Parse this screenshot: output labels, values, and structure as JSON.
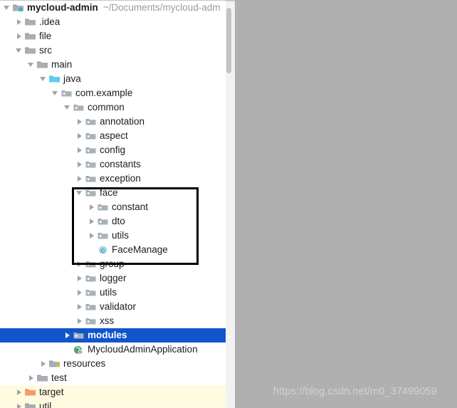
{
  "window": {
    "background_color": "#b0b0b0",
    "panel_background": "#ffffff",
    "selection_color": "#1155cc",
    "tinted_row_color": "#fffbe0",
    "highlight_box_color": "#000000"
  },
  "watermark": {
    "text": "https://blog.csdn.net/m0_37499059"
  },
  "project_tree": {
    "root": {
      "name": "mycloud-admin",
      "path": "~/Documents/mycloud-adm"
    },
    "rows": [
      {
        "label": "mycloud-admin",
        "path": "~/Documents/mycloud-adm",
        "depth": 0,
        "twisty": "expanded",
        "icon": "module-folder-icon",
        "bold": true,
        "state": "normal"
      },
      {
        "label": ".idea",
        "depth": 1,
        "twisty": "collapsed",
        "icon": "folder-icon",
        "bold": false,
        "state": "normal"
      },
      {
        "label": "file",
        "depth": 1,
        "twisty": "collapsed",
        "icon": "folder-icon",
        "bold": false,
        "state": "normal"
      },
      {
        "label": "src",
        "depth": 1,
        "twisty": "expanded",
        "icon": "folder-icon",
        "bold": false,
        "state": "normal"
      },
      {
        "label": "main",
        "depth": 2,
        "twisty": "expanded",
        "icon": "folder-icon",
        "bold": false,
        "state": "normal"
      },
      {
        "label": "java",
        "depth": 3,
        "twisty": "expanded",
        "icon": "source-root-icon",
        "bold": false,
        "state": "normal"
      },
      {
        "label": "com.example",
        "depth": 4,
        "twisty": "expanded",
        "icon": "package-icon",
        "bold": false,
        "state": "normal"
      },
      {
        "label": "common",
        "depth": 5,
        "twisty": "expanded",
        "icon": "package-icon",
        "bold": false,
        "state": "normal"
      },
      {
        "label": "annotation",
        "depth": 6,
        "twisty": "collapsed",
        "icon": "package-icon",
        "bold": false,
        "state": "normal"
      },
      {
        "label": "aspect",
        "depth": 6,
        "twisty": "collapsed",
        "icon": "package-icon",
        "bold": false,
        "state": "normal"
      },
      {
        "label": "config",
        "depth": 6,
        "twisty": "collapsed",
        "icon": "package-icon",
        "bold": false,
        "state": "normal"
      },
      {
        "label": "constants",
        "depth": 6,
        "twisty": "collapsed",
        "icon": "package-icon",
        "bold": false,
        "state": "normal"
      },
      {
        "label": "exception",
        "depth": 6,
        "twisty": "collapsed",
        "icon": "package-icon",
        "bold": false,
        "state": "normal"
      },
      {
        "label": "face",
        "depth": 6,
        "twisty": "expanded",
        "icon": "package-icon",
        "bold": false,
        "state": "normal"
      },
      {
        "label": "constant",
        "depth": 7,
        "twisty": "collapsed",
        "icon": "package-icon",
        "bold": false,
        "state": "normal"
      },
      {
        "label": "dto",
        "depth": 7,
        "twisty": "collapsed",
        "icon": "package-icon",
        "bold": false,
        "state": "normal"
      },
      {
        "label": "utils",
        "depth": 7,
        "twisty": "collapsed",
        "icon": "package-icon",
        "bold": false,
        "state": "normal"
      },
      {
        "label": "FaceManage",
        "depth": 7,
        "twisty": "none",
        "icon": "java-class-icon",
        "bold": false,
        "state": "normal"
      },
      {
        "label": "group",
        "depth": 6,
        "twisty": "collapsed",
        "icon": "package-icon",
        "bold": false,
        "state": "normal"
      },
      {
        "label": "logger",
        "depth": 6,
        "twisty": "collapsed",
        "icon": "package-icon",
        "bold": false,
        "state": "normal"
      },
      {
        "label": "utils",
        "depth": 6,
        "twisty": "collapsed",
        "icon": "package-icon",
        "bold": false,
        "state": "normal"
      },
      {
        "label": "validator",
        "depth": 6,
        "twisty": "collapsed",
        "icon": "package-icon",
        "bold": false,
        "state": "normal"
      },
      {
        "label": "xss",
        "depth": 6,
        "twisty": "collapsed",
        "icon": "package-icon",
        "bold": false,
        "state": "normal"
      },
      {
        "label": "modules",
        "depth": 5,
        "twisty": "collapsed",
        "icon": "package-icon",
        "bold": true,
        "state": "selected"
      },
      {
        "label": "MycloudAdminApplication",
        "depth": 5,
        "twisty": "none",
        "icon": "spring-boot-class-icon",
        "bold": false,
        "state": "normal"
      },
      {
        "label": "resources",
        "depth": 3,
        "twisty": "collapsed",
        "icon": "resource-root-icon",
        "bold": false,
        "state": "normal"
      },
      {
        "label": "test",
        "depth": 2,
        "twisty": "collapsed",
        "icon": "folder-icon",
        "bold": false,
        "state": "normal"
      },
      {
        "label": "target",
        "depth": 1,
        "twisty": "collapsed",
        "icon": "excluded-folder-icon",
        "bold": false,
        "state": "tinted"
      },
      {
        "label": "util",
        "depth": 1,
        "twisty": "collapsed",
        "icon": "folder-icon",
        "bold": false,
        "state": "tinted"
      }
    ]
  }
}
